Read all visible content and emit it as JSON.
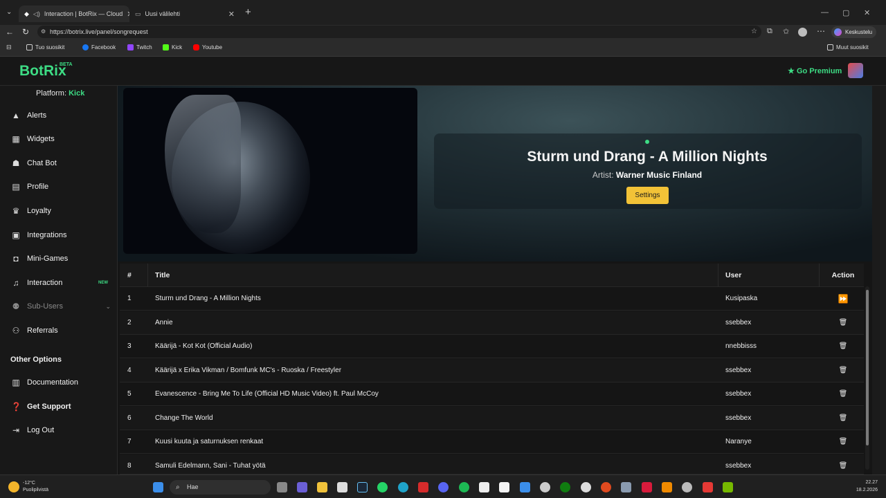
{
  "browser": {
    "tabs": [
      {
        "title": "Interaction | BotRix — Cloud",
        "active": true
      },
      {
        "title": "Uusi välilehti",
        "active": false
      }
    ],
    "url": "https://botrix.live/panel/songrequest",
    "profile_label": "Keskustelu",
    "bookmarks": [
      {
        "label": "Tuo suosikit",
        "color": "#cfcfcf"
      },
      {
        "label": "Facebook",
        "color": "#1877f2"
      },
      {
        "label": "Twitch",
        "color": "#9146ff"
      },
      {
        "label": "Kick",
        "color": "#53fc18"
      },
      {
        "label": "Youtube",
        "color": "#ff0000"
      }
    ],
    "other_bookmarks": "Muut suosikit"
  },
  "app": {
    "logo": "BotRix",
    "logo_badge": "BETA",
    "premium_label": "Go Premium",
    "accent": "#3ddc84"
  },
  "sidebar": {
    "platform_label": "Platform:",
    "platform_value": "Kick",
    "items": [
      {
        "label": "Alerts",
        "icon": "warning-icon"
      },
      {
        "label": "Widgets",
        "icon": "widgets-icon"
      },
      {
        "label": "Chat Bot",
        "icon": "robot-icon"
      },
      {
        "label": "Profile",
        "icon": "id-card-icon"
      },
      {
        "label": "Loyalty",
        "icon": "trophy-icon"
      },
      {
        "label": "Integrations",
        "icon": "plug-icon"
      },
      {
        "label": "Mini-Games",
        "icon": "gamepad-icon"
      },
      {
        "label": "Interaction",
        "icon": "music-icon",
        "badge": "NEW"
      },
      {
        "label": "Sub-Users",
        "icon": "users-icon"
      },
      {
        "label": "Referrals",
        "icon": "user-group-icon"
      }
    ],
    "other_options_heading": "Other Options",
    "other_items": [
      {
        "label": "Documentation",
        "icon": "book-icon"
      },
      {
        "label": "Get Support",
        "icon": "help-icon"
      },
      {
        "label": "Log Out",
        "icon": "logout-icon"
      }
    ]
  },
  "now_playing": {
    "title": "Sturm und Drang - A Million Nights",
    "artist_label": "Artist:",
    "artist": "Warner Music Finland",
    "settings_label": "Settings"
  },
  "queue": {
    "headers": {
      "num": "#",
      "title": "Title",
      "user": "User",
      "action": "Action"
    },
    "rows": [
      {
        "num": "1",
        "title": "Sturm und Drang - A Million Nights",
        "user": "Kusipaska",
        "action": "skip"
      },
      {
        "num": "2",
        "title": "Annie",
        "user": "ssebbex",
        "action": "delete"
      },
      {
        "num": "3",
        "title": "Käärijä - Kot Kot (Official Audio)",
        "user": "nnebbisss",
        "action": "delete"
      },
      {
        "num": "4",
        "title": "Käärijä x Erika Vikman / Bomfunk MC's - Ruoska / Freestyler",
        "user": "ssebbex",
        "action": "delete"
      },
      {
        "num": "5",
        "title": "Evanescence - Bring Me To Life (Official HD Music Video) ft. Paul McCoy",
        "user": "ssebbex",
        "action": "delete"
      },
      {
        "num": "6",
        "title": "Change The World",
        "user": "ssebbex",
        "action": "delete"
      },
      {
        "num": "7",
        "title": "Kuusi kuuta ja saturnuksen renkaat",
        "user": "Naranye",
        "action": "delete"
      },
      {
        "num": "8",
        "title": "Samuli Edelmann, Sani - Tuhat yötä",
        "user": "ssebbex",
        "action": "delete"
      }
    ]
  },
  "taskbar": {
    "weather_temp": "-12°C",
    "weather_desc": "Puolipilvistä",
    "search_placeholder": "Hae",
    "time": "22.27",
    "date": "18.2.2026"
  }
}
